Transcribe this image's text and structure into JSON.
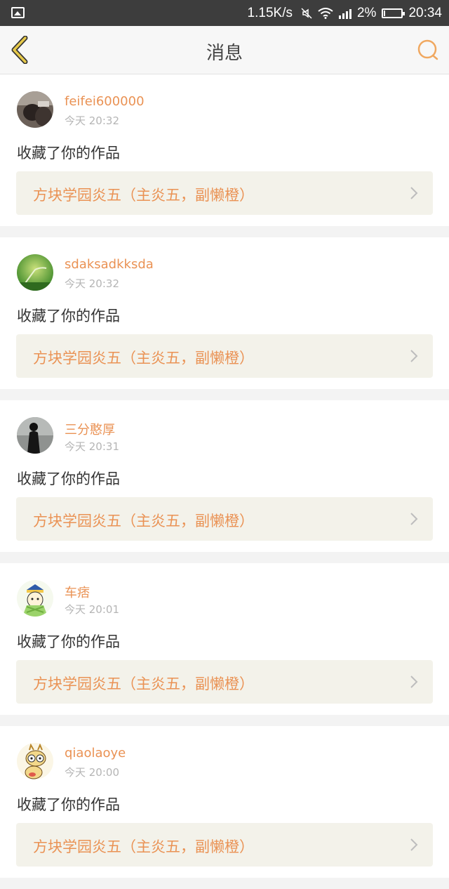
{
  "status_bar": {
    "speed": "1.15K/s",
    "battery_percent": "2%",
    "battery_level": 0.02,
    "time": "20:34",
    "icons": [
      "image-icon",
      "mute-icon",
      "wifi-icon",
      "signal-icon",
      "battery-icon"
    ]
  },
  "header": {
    "title": "消息",
    "back_icon": "chevron-left-icon",
    "search_icon": "search-icon",
    "accent_color": "#e6c94a"
  },
  "messages": [
    {
      "username": "feifei600000",
      "time": "今天 20:32",
      "action": "收藏了你的作品",
      "work_title": "方块学园炎五（主炎五，副懒橙）",
      "avatar": "dark-photo"
    },
    {
      "username": "sdaksadkksda",
      "time": "今天 20:32",
      "action": "收藏了你的作品",
      "work_title": "方块学园炎五（主炎五，副懒橙）",
      "avatar": "green-plant"
    },
    {
      "username": "三分憨厚",
      "time": "今天 20:31",
      "action": "收藏了你的作品",
      "work_title": "方块学园炎五（主炎五，副懒橙）",
      "avatar": "silhouette"
    },
    {
      "username": "车痞",
      "time": "今天 20:01",
      "action": "收藏了你的作品",
      "work_title": "方块学园炎五（主炎五，副懒橙）",
      "avatar": "cartoon-character"
    },
    {
      "username": "qiaolaoye",
      "time": "今天 20:00",
      "action": "收藏了你的作品",
      "work_title": "方块学园炎五（主炎五，副懒橙）",
      "avatar": "cartoon-giraffe"
    }
  ],
  "colors": {
    "username": "#ea9254",
    "work_link_bg": "#f3f2ea",
    "status_bar_bg": "#3d3d3d"
  }
}
